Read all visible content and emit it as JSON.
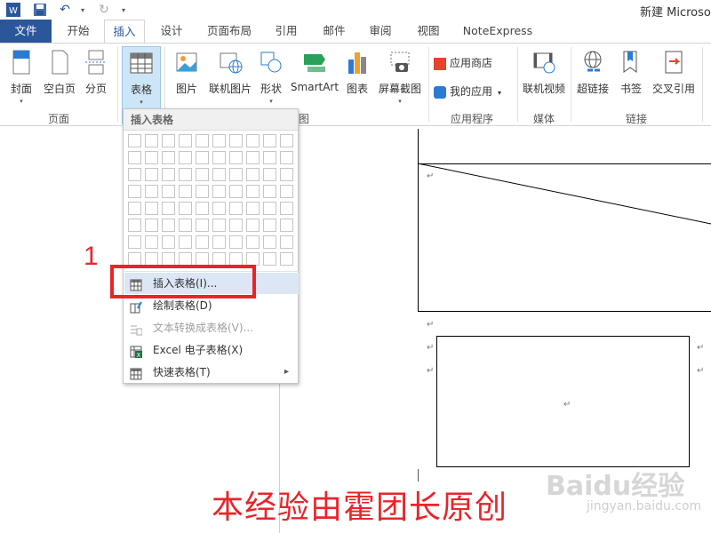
{
  "titlebar": {
    "doc_title": "新建 Microso",
    "undo_symbol": "↶",
    "redo_symbol": "↻"
  },
  "tabs": [
    {
      "label": "文件"
    },
    {
      "label": "开始"
    },
    {
      "label": "插入"
    },
    {
      "label": "设计"
    },
    {
      "label": "页面布局"
    },
    {
      "label": "引用"
    },
    {
      "label": "邮件"
    },
    {
      "label": "审阅"
    },
    {
      "label": "视图"
    },
    {
      "label": "NoteExpress"
    }
  ],
  "ribbon": {
    "pages_group": {
      "label": "页面",
      "buttons": [
        {
          "label": "封面"
        },
        {
          "label": "空白页"
        },
        {
          "label": "分页"
        }
      ]
    },
    "table_button": {
      "label": "表格"
    },
    "illustrations": {
      "buttons": [
        {
          "label": "图片"
        },
        {
          "label": "联机图片"
        },
        {
          "label": "形状"
        },
        {
          "label": "SmartArt"
        },
        {
          "label": "图表"
        },
        {
          "label": "屏幕截图"
        }
      ],
      "label_fragment": "图"
    },
    "apps_group": {
      "label": "应用程序",
      "store": "应用商店",
      "my_apps": "我的应用"
    },
    "media_group": {
      "label": "媒体",
      "buttons": [
        {
          "label": "联机视频"
        }
      ]
    },
    "links_group": {
      "label": "链接",
      "buttons": [
        {
          "label": "超链接"
        },
        {
          "label": "书签"
        },
        {
          "label": "交叉引用"
        }
      ]
    }
  },
  "dropdown": {
    "header": "插入表格",
    "grid": {
      "rows": 8,
      "cols": 10
    },
    "items": [
      {
        "label": "插入表格(I)...",
        "highlighted": true,
        "enabled": true,
        "icon": "table-icon"
      },
      {
        "label": "绘制表格(D)",
        "enabled": true,
        "icon": "draw-table-icon"
      },
      {
        "label": "文本转换成表格(V)...",
        "enabled": false,
        "icon": "text-to-table-icon"
      },
      {
        "label": "Excel 电子表格(X)",
        "enabled": true,
        "icon": "excel-icon"
      },
      {
        "label": "快速表格(T)",
        "enabled": true,
        "icon": "quick-table-icon",
        "submenu_arrow": "▸"
      }
    ]
  },
  "annotation": {
    "step_number": "1",
    "caption": "本经验由霍团长原创",
    "highlight_color": "#e8252a"
  },
  "watermark": {
    "text": "Baidu经验",
    "url": "jingyan.baidu.com"
  },
  "document": {
    "para_mark": "↵"
  },
  "colors": {
    "file_tab": "#2b579a",
    "ribbon_selected": "#cde6f7",
    "menu_highlight": "#dce6f4"
  }
}
